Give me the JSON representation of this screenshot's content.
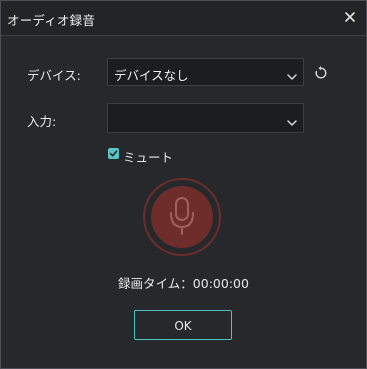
{
  "dialog": {
    "title": "オーディオ録音",
    "close_icon": "close-icon"
  },
  "device": {
    "label": "デバイス:",
    "value": "デバイスなし",
    "refresh_icon": "refresh-icon"
  },
  "input": {
    "label": "入力:",
    "value": ""
  },
  "mute": {
    "label": "ミュート",
    "checked": true
  },
  "record": {
    "icon": "microphone-icon",
    "color": "#6e2d2b"
  },
  "timer": {
    "text": "録画タイム：00:00:00"
  },
  "footer": {
    "ok_label": "OK"
  },
  "colors": {
    "accent": "#4bc0c0",
    "record": "#6e2d2b",
    "background": "#26282c"
  }
}
